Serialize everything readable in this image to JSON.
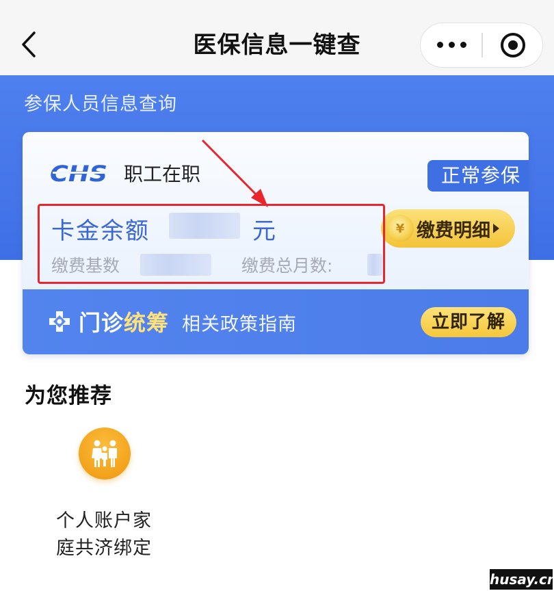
{
  "nav": {
    "title": "医保信息一键查",
    "back_icon": "chevron-left-icon",
    "more_icon": "more-dots-icon",
    "close_icon": "target-close-icon"
  },
  "header": {
    "section_title": "参保人员信息查询"
  },
  "card": {
    "logo_text": "CHS",
    "employment_type": "职工在职",
    "status": "正常参保",
    "balance_label": "卡金余额",
    "balance_unit": "元",
    "base_label": "缴费基数",
    "months_label": "缴费总月数:",
    "pay_detail_label": "缴费明细",
    "coin_symbol": "¥",
    "clinic_title_part1": "门诊",
    "clinic_title_part2": "统筹",
    "policy_text": "相关政策指南",
    "learn_button": "立即了解"
  },
  "recommend": {
    "title": "为您推荐",
    "items": [
      {
        "label_line1": "个人账户家",
        "label_line2": "庭共济绑定",
        "icon": "family-icon"
      }
    ]
  },
  "watermark": "husay.cn",
  "colors": {
    "brand_blue": "#3f6fe6",
    "accent_yellow": "#f5c63a",
    "highlight_red": "#e8262b"
  }
}
